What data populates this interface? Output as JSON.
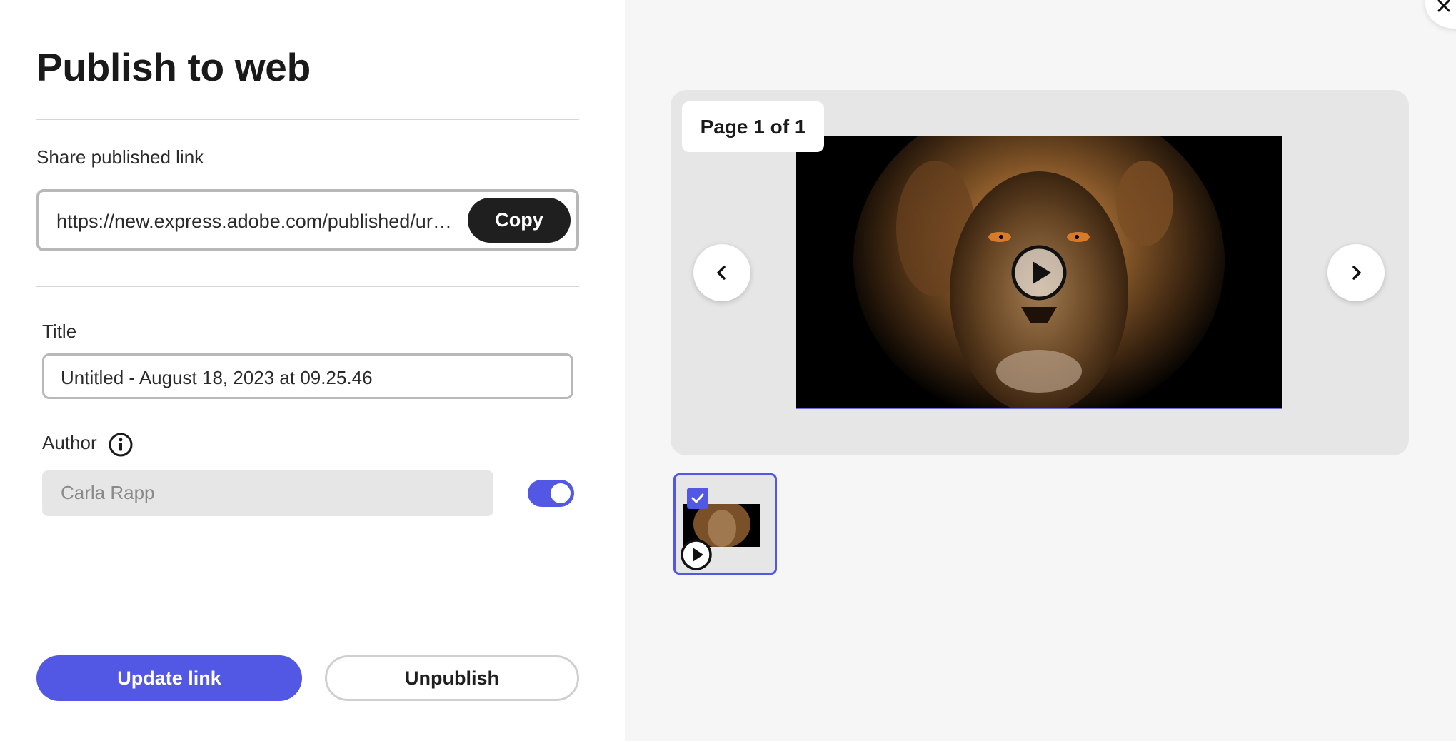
{
  "dialog": {
    "title": "Publish to web"
  },
  "share": {
    "label": "Share published link",
    "url": "https://new.express.adobe.com/published/urn:...",
    "copy_label": "Copy"
  },
  "title_field": {
    "label": "Title",
    "value": "Untitled - August 18, 2023 at 09.25.46"
  },
  "author_field": {
    "label": "Author",
    "value": "Carla Rapp",
    "toggle_on": true,
    "info_icon": "info-icon"
  },
  "actions": {
    "update_label": "Update link",
    "unpublish_label": "Unpublish"
  },
  "preview": {
    "page_indicator": "Page 1 of 1",
    "prev_icon": "chevron-left-icon",
    "next_icon": "chevron-right-icon",
    "play_icon": "play-icon"
  },
  "thumbnails": [
    {
      "selected": true,
      "has_video": true
    }
  ],
  "colors": {
    "accent": "#5258e4",
    "copy_button": "#1f1f1f",
    "right_panel_bg": "#f6f6f6",
    "preview_bg": "#e6e6e6"
  }
}
